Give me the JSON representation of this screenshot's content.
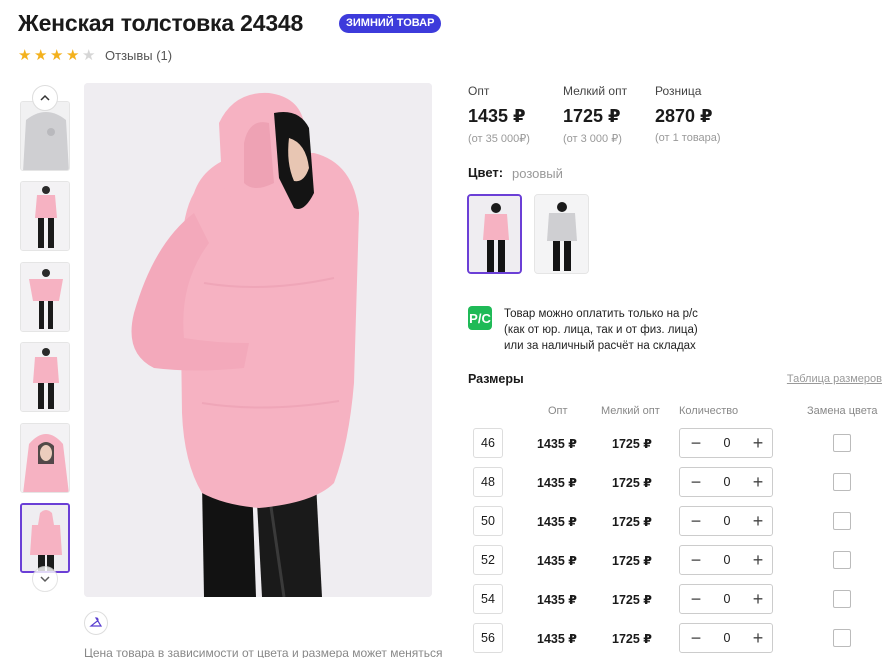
{
  "product": {
    "title": "Женская толстовка 24348",
    "badge": "ЗИМНИЙ ТОВАР",
    "rating": 4,
    "rating_max": 5,
    "reviews_label": "Отзывы (1)"
  },
  "gallery": {
    "thumb_count": 6,
    "active_thumb": 6,
    "note": "Цена товара в зависимости от цвета и размера может меняться"
  },
  "prices": [
    {
      "label": "Опт",
      "value": "1435 ₽",
      "sub": "(от 35 000₽)"
    },
    {
      "label": "Мелкий опт",
      "value": "1725 ₽",
      "sub": "(от 3 000 ₽)"
    },
    {
      "label": "Розница",
      "value": "2870 ₽",
      "sub": "(от 1 товара)"
    }
  ],
  "color": {
    "label": "Цвет:",
    "value": "розовый",
    "swatches": [
      {
        "name": "розовый",
        "active": true
      },
      {
        "name": "серый",
        "active": false
      }
    ]
  },
  "payment": {
    "icon_text": "Р/С",
    "lines": [
      "Товар можно оплатить только на р/с",
      "(как от юр. лица, так и от физ. лица)",
      "или за наличный расчёт на складах"
    ]
  },
  "sizes": {
    "heading": "Размеры",
    "table_link": "Таблица размеров",
    "headers": {
      "wholesale": "Опт",
      "small": "Мелкий опт",
      "qty": "Количество",
      "swap": "Замена цвета"
    },
    "rows": [
      {
        "size": "46",
        "wholesale": "1435 ₽",
        "small": "1725 ₽",
        "qty": "0"
      },
      {
        "size": "48",
        "wholesale": "1435 ₽",
        "small": "1725 ₽",
        "qty": "0"
      },
      {
        "size": "50",
        "wholesale": "1435 ₽",
        "small": "1725 ₽",
        "qty": "0"
      },
      {
        "size": "52",
        "wholesale": "1435 ₽",
        "small": "1725 ₽",
        "qty": "0"
      },
      {
        "size": "54",
        "wholesale": "1435 ₽",
        "small": "1725 ₽",
        "qty": "0"
      },
      {
        "size": "56",
        "wholesale": "1435 ₽",
        "small": "1725 ₽",
        "qty": "0"
      }
    ]
  },
  "colors": {
    "accent": "#6b3fd6",
    "badge": "#3d3bdb",
    "star": "#f3b11d",
    "pay_icon": "#1fba57",
    "product_pink": "#f6b2c2"
  }
}
